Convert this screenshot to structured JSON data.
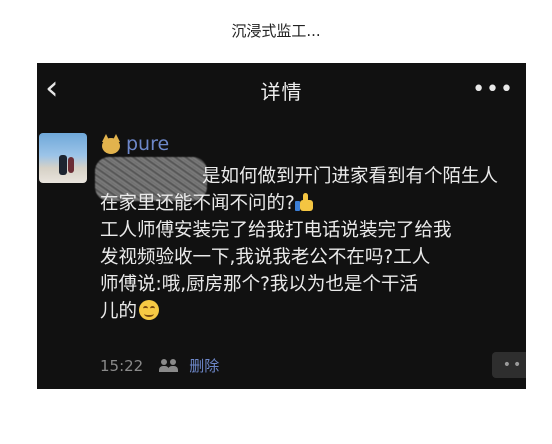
{
  "caption": "沉浸式监工...",
  "navbar": {
    "back_icon": "chevron-left-icon",
    "back_glyph": "‹",
    "title": "详情",
    "more_glyph": "•••"
  },
  "post": {
    "username": "pure",
    "text_line1": "是如何做到开门进家看到有个陌生人",
    "text_line2": "在家里还能不闻不问的?",
    "text_body": "工人师傅安装完了给我打电话说装完了给我\n发视频验收一下,我说我老公不在吗?工人\n师傅说:哦,厨房那个?我以为也是个干活\n儿的",
    "time": "15:22",
    "delete_label": "删除",
    "more_glyph": "••"
  },
  "colors": {
    "background": "#111111",
    "link": "#6d87c9",
    "text": "#eaeaea",
    "muted": "#8a8a8a"
  }
}
